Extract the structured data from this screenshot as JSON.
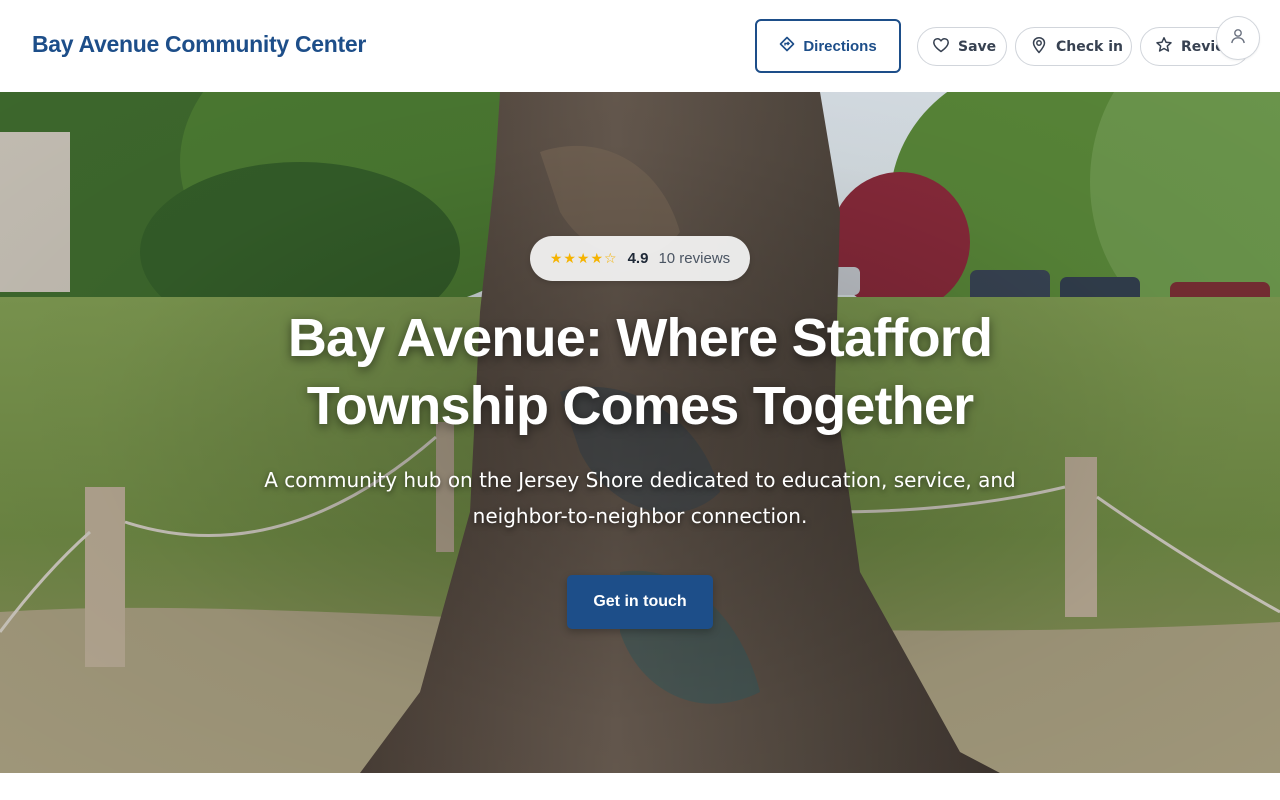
{
  "header": {
    "brand": "Bay Avenue Community Center",
    "directions_label": "Directions",
    "save_label": "Save",
    "checkin_label": "Check in",
    "review_label": "Review"
  },
  "hero": {
    "stars": "★★★★☆",
    "rating_value": "4.9",
    "review_count": "10 reviews",
    "title": "Bay Avenue: Where Stafford Township Comes Together",
    "subtitle": "A community hub on the Jersey Shore dedicated to education, service, and neighbor-to-neighbor connection.",
    "cta_label": "Get in touch"
  },
  "colors": {
    "brand": "#1d4e89",
    "star": "#f5b301"
  },
  "icons": {
    "directions": "directions-icon",
    "save": "heart-icon",
    "checkin": "map-pin-icon",
    "review": "star-icon",
    "account": "user-icon"
  }
}
